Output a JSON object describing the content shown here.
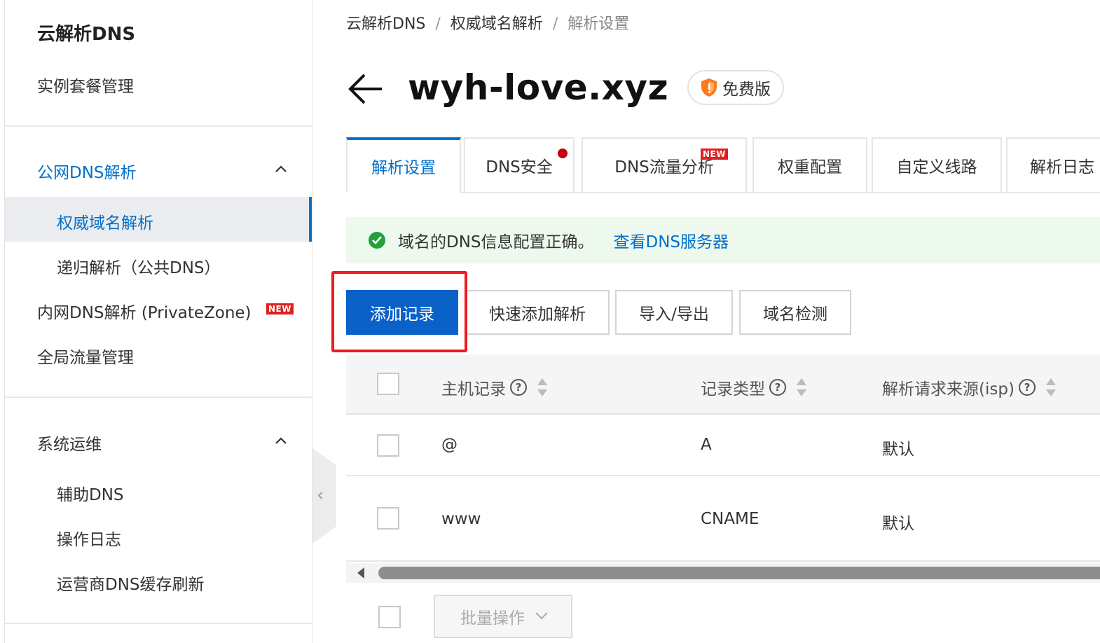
{
  "sidebar": {
    "title": "云解析DNS",
    "items": [
      {
        "label": "实例套餐管理"
      },
      {
        "label": "公网DNS解析"
      },
      {
        "label": "权威域名解析"
      },
      {
        "label": "递归解析（公共DNS）"
      },
      {
        "label": "内网DNS解析 (PrivateZone)",
        "badge": "NEW"
      },
      {
        "label": "全局流量管理"
      },
      {
        "label": "系统运维"
      },
      {
        "label": "辅助DNS"
      },
      {
        "label": "操作日志"
      },
      {
        "label": "运营商DNS缓存刷新"
      }
    ]
  },
  "breadcrumb": [
    "云解析DNS",
    "权威域名解析",
    "解析设置"
  ],
  "domain": {
    "name": "wyh-love.xyz",
    "plan": "免费版"
  },
  "tabs": [
    {
      "label": "解析设置"
    },
    {
      "label": "DNS安全"
    },
    {
      "label": "DNS流量分析",
      "badge": "NEW"
    },
    {
      "label": "权重配置"
    },
    {
      "label": "自定义线路"
    },
    {
      "label": "解析日志"
    }
  ],
  "notice": {
    "text": "域名的DNS信息配置正确。",
    "link": "查看DNS服务器"
  },
  "toolbar": {
    "add_record": "添加记录",
    "quick_add": "快速添加解析",
    "import_export": "导入/导出",
    "domain_check": "域名检测"
  },
  "table": {
    "columns": [
      "主机记录",
      "记录类型",
      "解析请求来源(isp)"
    ],
    "help_glyph": "?",
    "rows": [
      {
        "host": "@",
        "type": "A",
        "isp": "默认"
      },
      {
        "host": "www",
        "type": "CNAME",
        "isp": "默认"
      }
    ]
  },
  "footer": {
    "batch_label": "批量操作"
  },
  "colors": {
    "accent": "#0070cc",
    "primary_button": "#0a62c9",
    "highlight": "#ee1c1c",
    "success": "#22a03c",
    "badge": "#e02020"
  }
}
